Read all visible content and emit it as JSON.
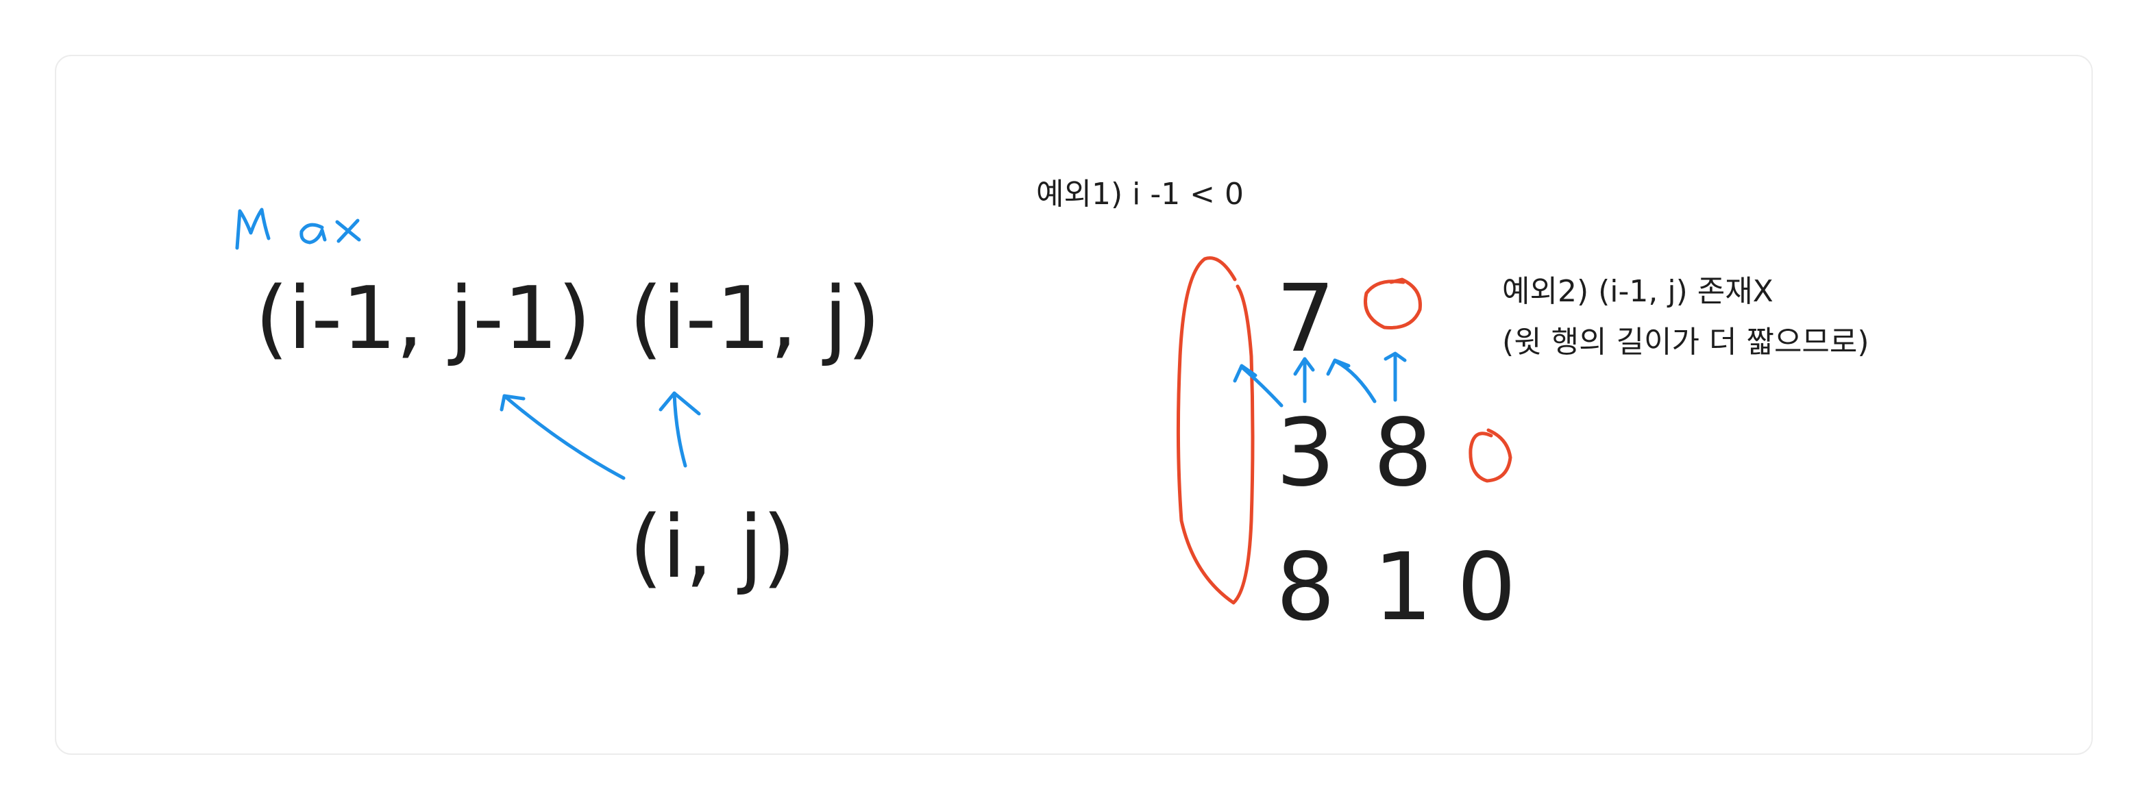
{
  "left": {
    "max_label": "Max",
    "top_left_cell": "(i-1, j-1)",
    "top_right_cell": "(i-1, j)",
    "current_cell": "(i, j)"
  },
  "right": {
    "exception1": "예외1) i -1 < 0",
    "exception2_line1": "예외2) (i-1, j) 존재X",
    "exception2_line2": "(윗 행의 길이가 더 짧으므로)",
    "triangle": {
      "row1": [
        "7"
      ],
      "row2": [
        "3",
        "8"
      ],
      "row3": [
        "8",
        "1",
        "0"
      ]
    }
  },
  "colors": {
    "ink": "#1e1e1e",
    "blue_pen": "#1e90e8",
    "red_pen": "#e8492a",
    "card_border": "#ececec"
  }
}
